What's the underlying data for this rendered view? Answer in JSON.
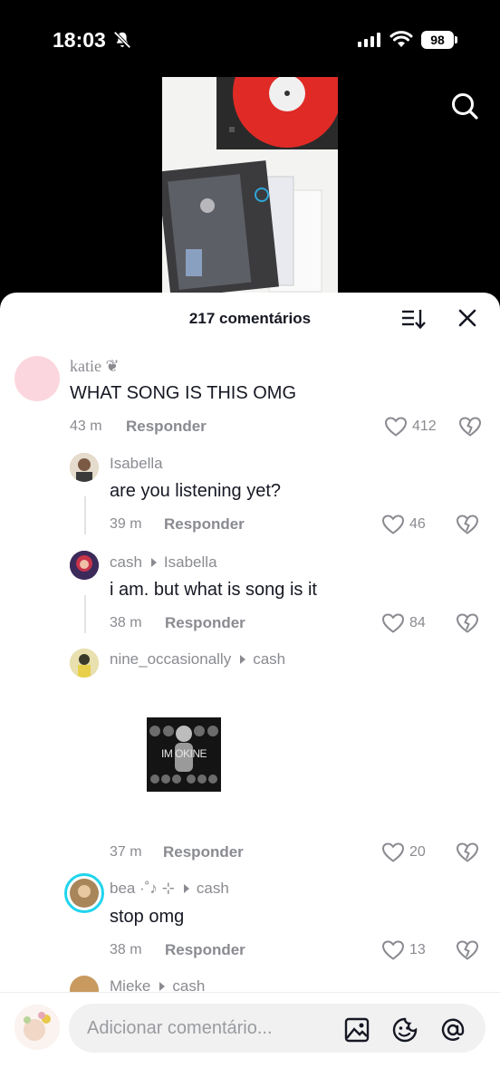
{
  "status_bar": {
    "time": "18:03",
    "battery": "98"
  },
  "sheet": {
    "title": "217 comentários"
  },
  "comments": [
    {
      "user": "katie ❦",
      "text": "WHAT SONG IS THIS OMG",
      "time": "43 m",
      "reply": "Responder",
      "likes": "412"
    },
    {
      "user": "Isabella",
      "text": "are you listening yet?",
      "time": "39 m",
      "reply": "Responder",
      "likes": "46"
    },
    {
      "user": "cash",
      "reply_to": "Isabella",
      "text": "i am. but what is song is it",
      "time": "38 m",
      "reply": "Responder",
      "likes": "84"
    },
    {
      "user": "nine_occasionally",
      "reply_to": "cash",
      "sticker_text": "IM OKINE",
      "time": "37 m",
      "reply": "Responder",
      "likes": "20"
    },
    {
      "user": "bea ·˚♪ ⊹",
      "reply_to": "cash",
      "text": "stop omg",
      "time": "38 m",
      "reply": "Responder",
      "likes": "13"
    },
    {
      "user": "Mieke",
      "reply_to": "cash"
    }
  ],
  "composer": {
    "placeholder": "Adicionar comentário..."
  },
  "colors": {
    "accent": "#161823",
    "muted": "#8a8b91",
    "record": "#e02a26",
    "story_ring": "#20d5ec"
  }
}
